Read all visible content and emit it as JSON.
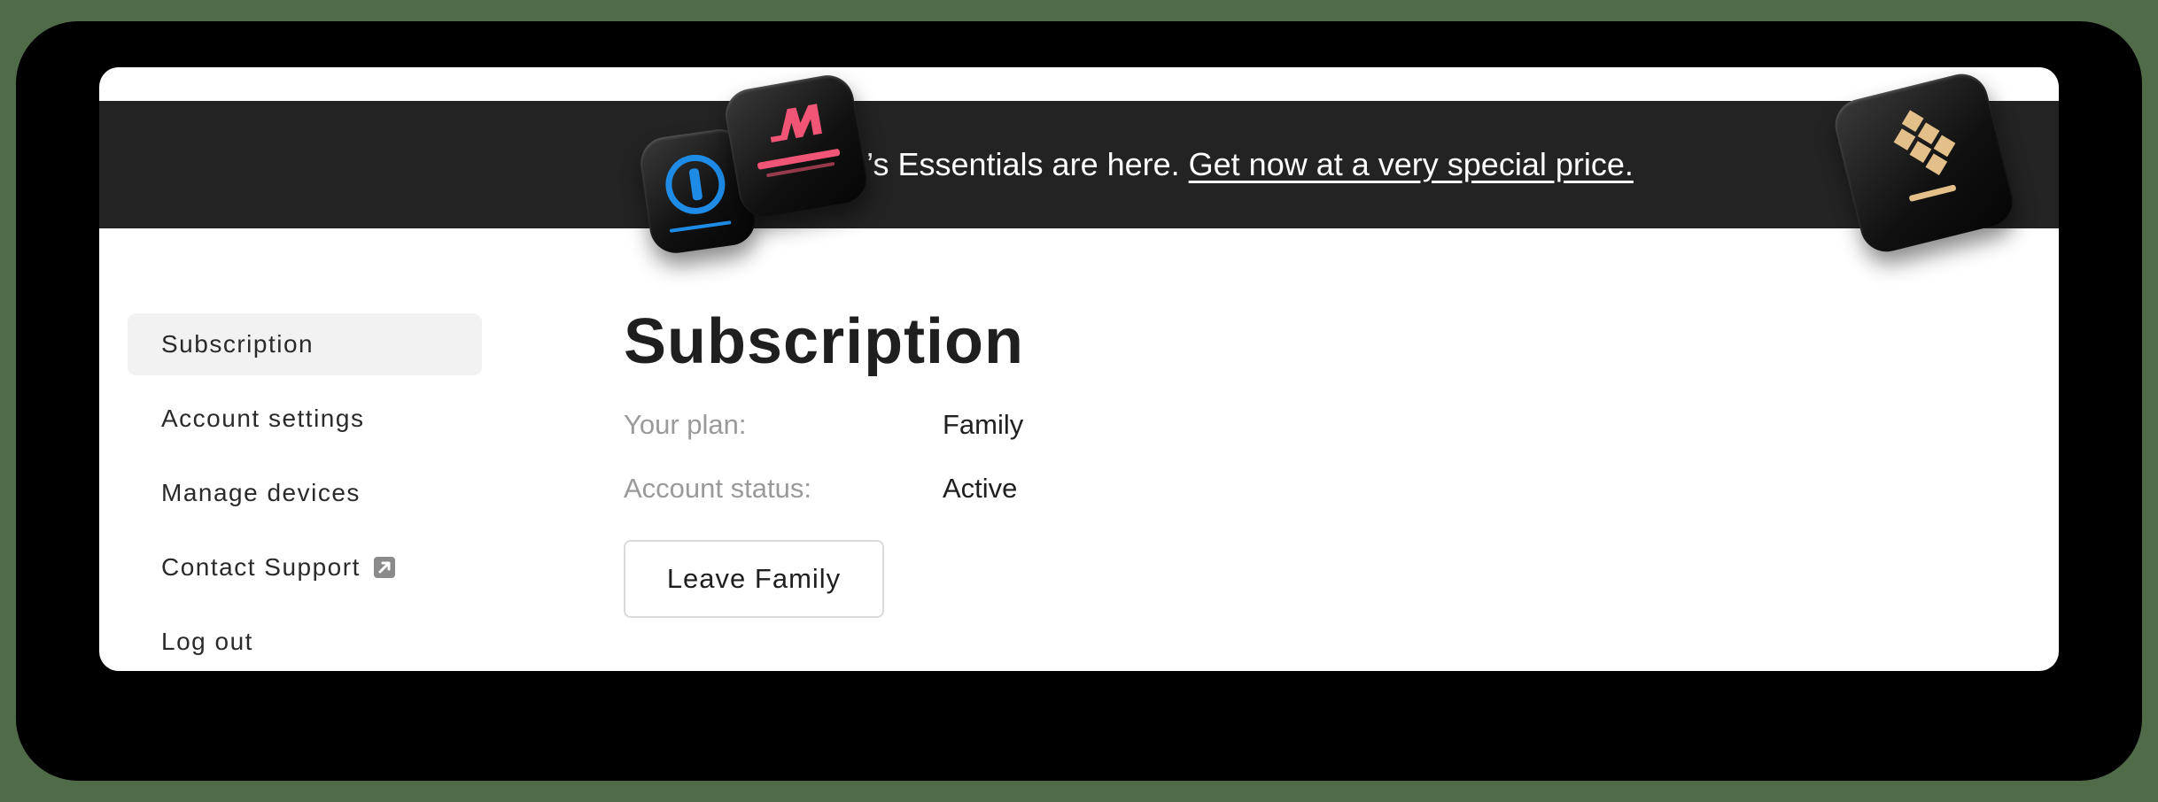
{
  "banner": {
    "text": "Pro’s Essentials are here.",
    "link": "Get now at a very special price.",
    "tiles": {
      "one_password": {
        "icon": "1password-logo-icon",
        "color": "#1e8be6",
        "caption": "1Password"
      },
      "masterclass": {
        "icon": "masterclass-logo-icon",
        "color": "#f05575",
        "caption": "MasterClass"
      },
      "setapp": {
        "icon": "setapp-logo-icon",
        "color": "#e3c08a",
        "caption": "SETAPP"
      }
    }
  },
  "sidebar": {
    "items": [
      {
        "label": "Subscription",
        "active": true
      },
      {
        "label": "Account settings"
      },
      {
        "label": "Manage devices"
      },
      {
        "label": "Contact Support",
        "icon": "external-link-icon"
      },
      {
        "label": "Log out"
      }
    ]
  },
  "main": {
    "title": "Subscription",
    "fields": [
      {
        "label": "Your plan:",
        "value": "Family"
      },
      {
        "label": "Account status:",
        "value": "Active"
      }
    ],
    "leave_button": "Leave Family"
  },
  "colors": {
    "banner_bg": "#232323",
    "active_nav_bg": "#f2f2f2",
    "label_gray": "#9a9a9a",
    "text_dark": "#1f1f1f"
  }
}
